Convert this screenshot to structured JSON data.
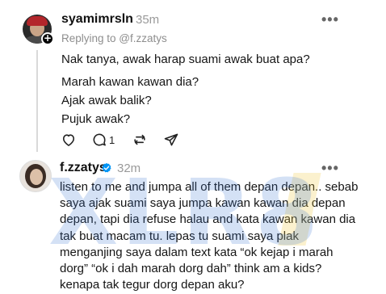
{
  "post1": {
    "username": "syamimrsln",
    "time": "35m",
    "more": "•••",
    "reply_to": "Replying to @f.zzatys",
    "lines": [
      "Nak tanya, awak harap suami awak buat apa?",
      "Marah kawan kawan dia?",
      "Ajak awak balik?",
      "Pujuk awak?"
    ],
    "actions": {
      "reply_count": "1"
    },
    "follow_symbol": "+"
  },
  "post2": {
    "username": "f.zzatys",
    "time": "32m",
    "more": "•••",
    "lines": [
      "listen to me and jumpa all of them depan depan.. sebab",
      "saya ajak suami saya jumpa kawan kawan dia depan",
      "depan, tapi dia refuse halau and kata kawan kawan dia",
      "tak buat macam tu. lepas tu suami saya plak",
      "menganjing saya dalam text kata “ok kejap i marah",
      "dorg” “ok i dah marah dorg dah” think am a kids?",
      "kenapa tak tegur dorg depan aku?"
    ]
  },
  "watermark": {
    "text": "XLR8"
  },
  "colors": {
    "verified": "#0095f6",
    "muted": "#9a9a9a",
    "thread_line": "#d9d9d9"
  }
}
